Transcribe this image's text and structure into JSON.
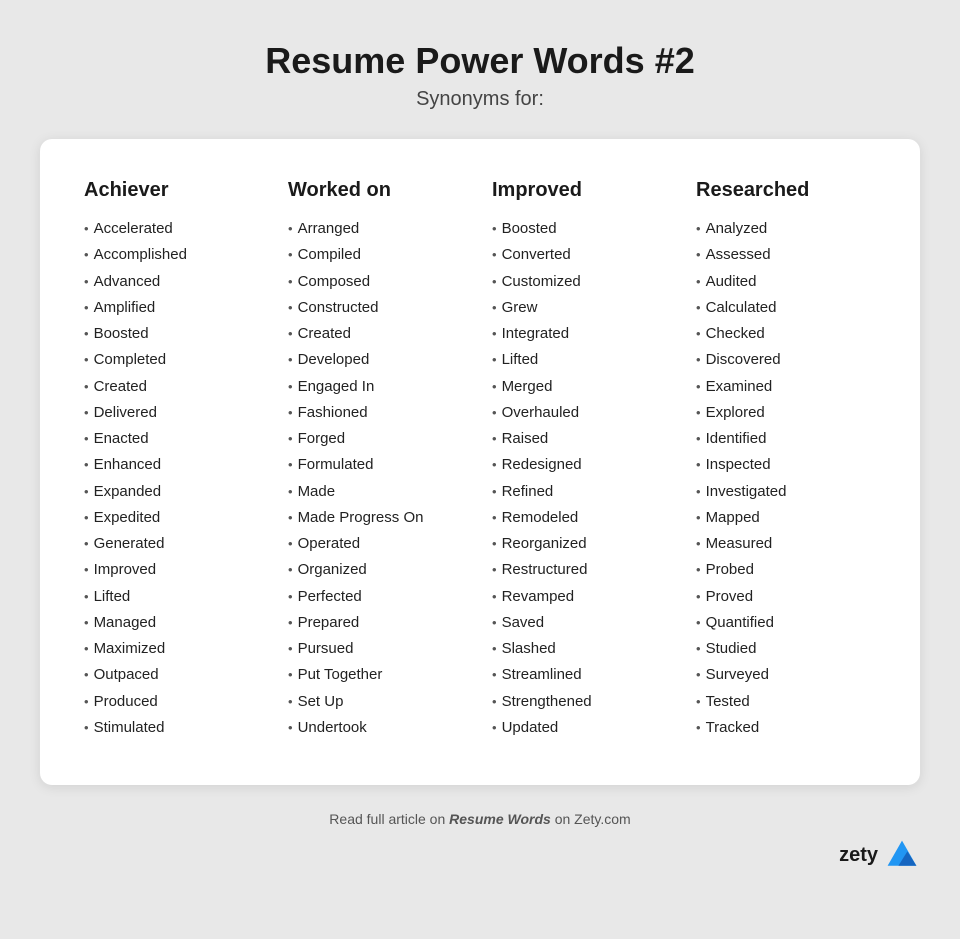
{
  "header": {
    "title": "Resume Power Words #2",
    "subtitle": "Synonyms for:"
  },
  "columns": [
    {
      "header": "Achiever",
      "words": [
        "Accelerated",
        "Accomplished",
        "Advanced",
        "Amplified",
        "Boosted",
        "Completed",
        "Created",
        "Delivered",
        "Enacted",
        "Enhanced",
        "Expanded",
        "Expedited",
        "Generated",
        "Improved",
        "Lifted",
        "Managed",
        "Maximized",
        "Outpaced",
        "Produced",
        "Stimulated"
      ]
    },
    {
      "header": "Worked on",
      "words": [
        "Arranged",
        "Compiled",
        "Composed",
        "Constructed",
        "Created",
        "Developed",
        "Engaged In",
        "Fashioned",
        "Forged",
        "Formulated",
        "Made",
        "Made Progress On",
        "Operated",
        "Organized",
        "Perfected",
        "Prepared",
        "Pursued",
        "Put Together",
        "Set Up",
        "Undertook"
      ]
    },
    {
      "header": "Improved",
      "words": [
        "Boosted",
        "Converted",
        "Customized",
        "Grew",
        "Integrated",
        "Lifted",
        "Merged",
        "Overhauled",
        "Raised",
        "Redesigned",
        "Refined",
        "Remodeled",
        "Reorganized",
        "Restructured",
        "Revamped",
        "Saved",
        "Slashed",
        "Streamlined",
        "Strengthened",
        "Updated"
      ]
    },
    {
      "header": "Researched",
      "words": [
        "Analyzed",
        "Assessed",
        "Audited",
        "Calculated",
        "Checked",
        "Discovered",
        "Examined",
        "Explored",
        "Identified",
        "Inspected",
        "Investigated",
        "Mapped",
        "Measured",
        "Probed",
        "Proved",
        "Quantified",
        "Studied",
        "Surveyed",
        "Tested",
        "Tracked"
      ]
    }
  ],
  "footer": {
    "text_pre": "Read full article on ",
    "link_text": "Resume Words",
    "text_post": " on Zety.com"
  },
  "brand": {
    "name": "zety"
  }
}
